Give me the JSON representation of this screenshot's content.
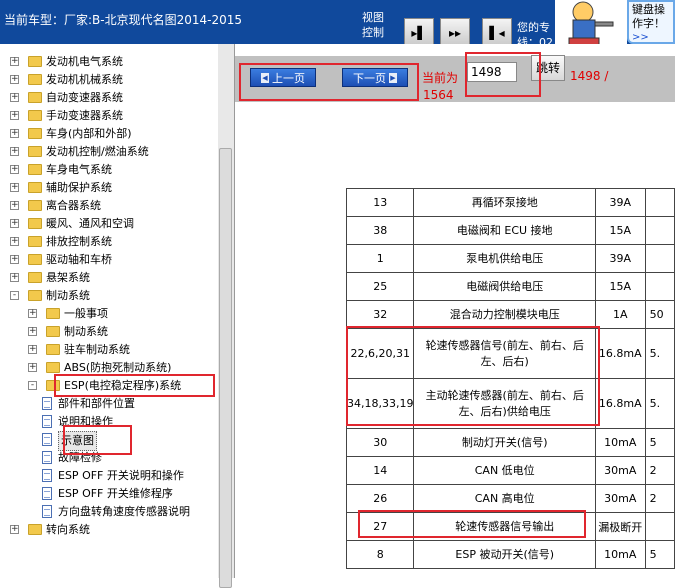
{
  "header": {
    "car_title": "当前车型：厂家:B-北京现代名图2014-2015",
    "view_label": "视图控制",
    "view_buttons": [
      "single-page",
      "two-page",
      "back"
    ],
    "expert_text": "您的专线：02"
  },
  "tip": {
    "text": "键盘操作字！",
    "link": ">>"
  },
  "sidebar": {
    "items": [
      {
        "label": "发动机电气系统",
        "expander": "+",
        "icon": "folder"
      },
      {
        "label": "发动机机械系统",
        "expander": "+",
        "icon": "folder"
      },
      {
        "label": "自动变速器系统",
        "expander": "+",
        "icon": "folder"
      },
      {
        "label": "手动变速器系统",
        "expander": "+",
        "icon": "folder"
      },
      {
        "label": "车身(内部和外部)",
        "expander": "+",
        "icon": "folder"
      },
      {
        "label": "发动机控制/燃油系统",
        "expander": "+",
        "icon": "folder"
      },
      {
        "label": "车身电气系统",
        "expander": "+",
        "icon": "folder"
      },
      {
        "label": "辅助保护系统",
        "expander": "+",
        "icon": "folder"
      },
      {
        "label": "离合器系统",
        "expander": "+",
        "icon": "folder"
      },
      {
        "label": "暖风、通风和空调",
        "expander": "+",
        "icon": "folder"
      },
      {
        "label": "排放控制系统",
        "expander": "+",
        "icon": "folder"
      },
      {
        "label": "驱动轴和车桥",
        "expander": "+",
        "icon": "folder"
      },
      {
        "label": "悬架系统",
        "expander": "+",
        "icon": "folder"
      },
      {
        "label": "制动系统",
        "expander": "-",
        "icon": "folder"
      },
      {
        "label": "一般事项",
        "expander": "+",
        "icon": "folder"
      },
      {
        "label": "制动系统",
        "expander": "+",
        "icon": "folder"
      },
      {
        "label": "驻车制动系统",
        "expander": "+",
        "icon": "folder"
      },
      {
        "label": "ABS(防抱死制动系统)",
        "expander": "+",
        "icon": "folder"
      },
      {
        "label": "ESP(电控稳定程序)系统",
        "expander": "-",
        "icon": "folder"
      },
      {
        "label": "部件和部件位置",
        "icon": "doc"
      },
      {
        "label": "说明和操作",
        "icon": "doc"
      },
      {
        "label": "示意图",
        "icon": "doc",
        "selected": true
      },
      {
        "label": "故障检修",
        "icon": "doc"
      },
      {
        "label": "ESP OFF 开关说明和操作",
        "icon": "doc"
      },
      {
        "label": "ESP OFF 开关维修程序",
        "icon": "doc"
      },
      {
        "label": "方向盘转角速度传感器说明",
        "icon": "doc"
      },
      {
        "label": "转向系统",
        "expander": "+",
        "icon": "folder"
      }
    ]
  },
  "pager": {
    "prev_label": "上一页",
    "next_label": "下一页",
    "current_label": "当前为",
    "page_value": "1498",
    "jump_label": "跳转",
    "total_line1": "1498 /",
    "total_line2": "1564"
  },
  "table": {
    "rows": [
      {
        "pin": "13",
        "desc": "再循环泵接地",
        "cur": "39A",
        "extra": ""
      },
      {
        "pin": "38",
        "desc": "电磁阀和 ECU 接地",
        "cur": "15A",
        "extra": ""
      },
      {
        "pin": "1",
        "desc": "泵电机供给电压",
        "cur": "39A",
        "extra": ""
      },
      {
        "pin": "25",
        "desc": "电磁阀供给电压",
        "cur": "15A",
        "extra": ""
      },
      {
        "pin": "32",
        "desc": "混合动力控制模块电压",
        "cur": "1A",
        "extra": "50"
      },
      {
        "pin": "22,6,20,31",
        "desc": "轮速传感器信号(前左、前右、后左、后右)",
        "cur": "16.8mA",
        "extra": "5."
      },
      {
        "pin": "34,18,33,19",
        "desc": "主动轮速传感器(前左、前右、后左、后右)供给电压",
        "cur": "16.8mA",
        "extra": "5."
      },
      {
        "pin": "30",
        "desc": "制动灯开关(信号)",
        "cur": "10mA",
        "extra": "5"
      },
      {
        "pin": "14",
        "desc": "CAN 低电位",
        "cur": "30mA",
        "extra": "2"
      },
      {
        "pin": "26",
        "desc": "CAN 高电位",
        "cur": "30mA",
        "extra": "2"
      },
      {
        "pin": "27",
        "desc": "轮速传感器信号输出",
        "cur": "漏极断开",
        "extra": ""
      },
      {
        "pin": "8",
        "desc": "ESP 被动开关(信号)",
        "cur": "10mA",
        "extra": "5"
      }
    ]
  },
  "colors": {
    "header_bg": "#10499c",
    "highlight_red": "#e0262e",
    "page_text_red": "#e00000",
    "nav_bg": "#c0c0c0"
  }
}
